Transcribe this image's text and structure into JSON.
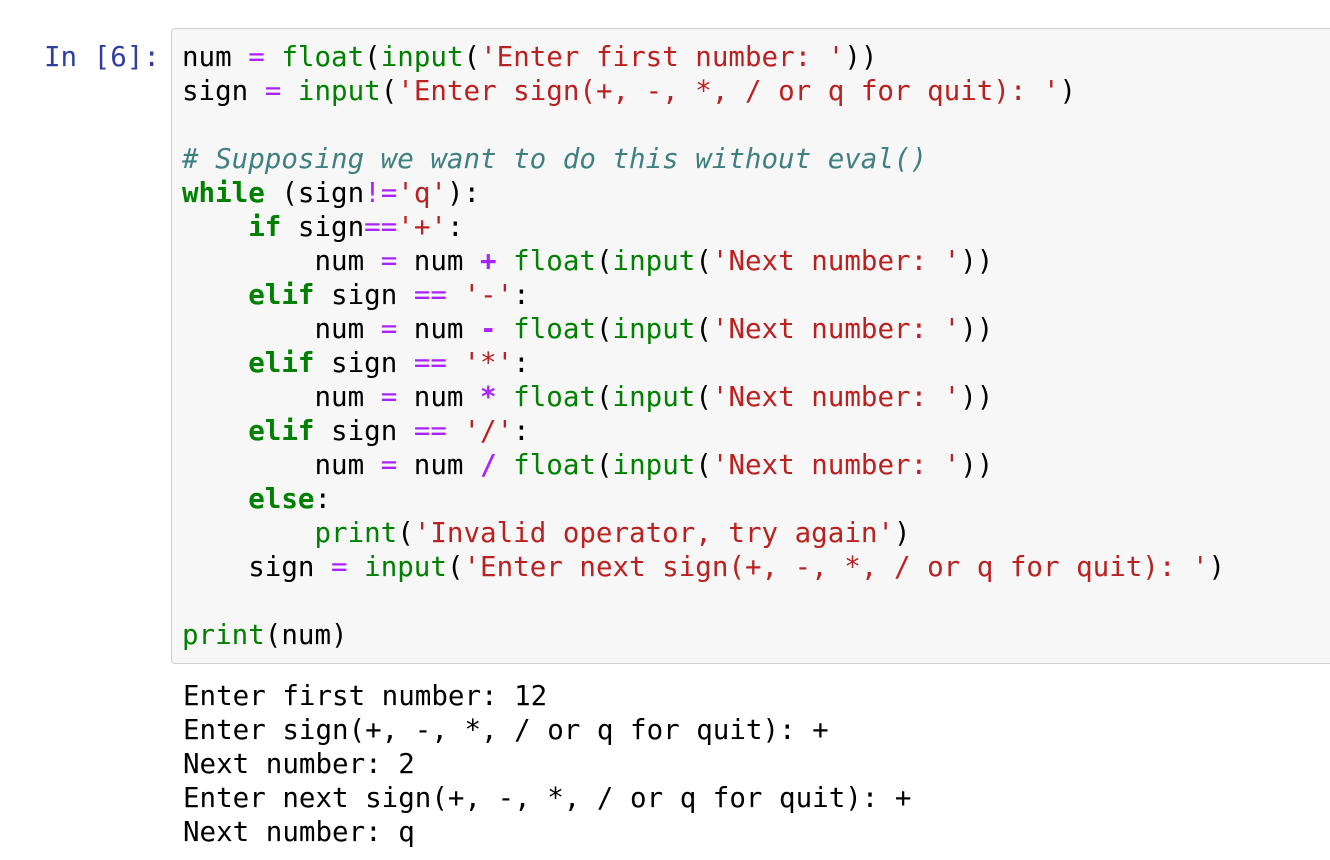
{
  "cell": {
    "prompt": "In [6]:",
    "code": {
      "l1": [
        "num",
        " ",
        "=",
        " ",
        "float",
        "(",
        "input",
        "(",
        "'Enter first number: '",
        "))"
      ],
      "l2": [
        "sign",
        " ",
        "=",
        " ",
        "input",
        "(",
        "'Enter sign(+, -, *, / or q for quit): '",
        ")"
      ],
      "l4": [
        "# Supposing we want to do this without eval()"
      ],
      "l5": [
        "while",
        " (sign",
        "!=",
        "'q'",
        "):"
      ],
      "l6": [
        "    ",
        "if",
        " sign",
        "==",
        "'+'",
        ":"
      ],
      "l7": [
        "        num ",
        "=",
        " num ",
        "+",
        " ",
        "float",
        "(",
        "input",
        "(",
        "'Next number: '",
        "))"
      ],
      "l8": [
        "    ",
        "elif",
        " sign ",
        "==",
        " ",
        "'-'",
        ":"
      ],
      "l9": [
        "        num ",
        "=",
        " num ",
        "-",
        " ",
        "float",
        "(",
        "input",
        "(",
        "'Next number: '",
        "))"
      ],
      "l10": [
        "    ",
        "elif",
        " sign ",
        "==",
        " ",
        "'*'",
        ":"
      ],
      "l11": [
        "        num ",
        "=",
        " num ",
        "*",
        " ",
        "float",
        "(",
        "input",
        "(",
        "'Next number: '",
        "))"
      ],
      "l12": [
        "    ",
        "elif",
        " sign ",
        "==",
        " ",
        "'/'",
        ":"
      ],
      "l13": [
        "        num ",
        "=",
        " num ",
        "/",
        " ",
        "float",
        "(",
        "input",
        "(",
        "'Next number: '",
        "))"
      ],
      "l14": [
        "    ",
        "else",
        ":"
      ],
      "l15": [
        "        ",
        "print",
        "(",
        "'Invalid operator, try again'",
        ")"
      ],
      "l16": [
        "    sign ",
        "=",
        " ",
        "input",
        "(",
        "'Enter next sign(+, -, *, / or q for quit): '",
        ")"
      ],
      "l18": [
        "print",
        "(num)"
      ]
    },
    "output": [
      "Enter first number: 12",
      "Enter sign(+, -, *, / or q for quit): +",
      "Next number: 2",
      "Enter next sign(+, -, *, / or q for quit): +",
      "Next number: q"
    ]
  }
}
